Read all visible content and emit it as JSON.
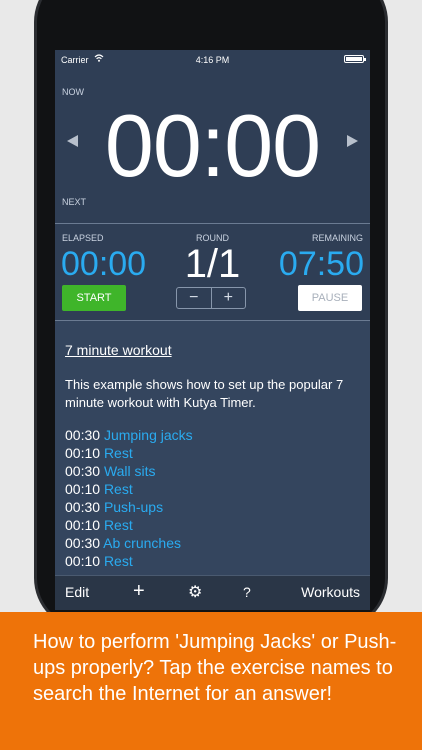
{
  "status_bar": {
    "carrier": "Carrier",
    "time": "4:16 PM"
  },
  "timer": {
    "now_label": "NOW",
    "current_time": "00:00",
    "next_label": "NEXT"
  },
  "stats": {
    "elapsed_label": "ELAPSED",
    "elapsed_value": "00:00",
    "round_label": "ROUND",
    "round_value": "1/1",
    "remaining_label": "REMAINING",
    "remaining_value": "07:50"
  },
  "controls": {
    "start_label": "START",
    "minus_label": "−",
    "plus_label": "+",
    "pause_label": "PAUSE"
  },
  "workout": {
    "title": "7 minute workout",
    "description": "This example shows how to set up the popular 7 minute workout with Kutya Timer.",
    "exercises": [
      {
        "duration": "00:30",
        "name": "Jumping jacks"
      },
      {
        "duration": "00:10",
        "name": "Rest"
      },
      {
        "duration": "00:30",
        "name": "Wall sits"
      },
      {
        "duration": "00:10",
        "name": "Rest"
      },
      {
        "duration": "00:30",
        "name": "Push-ups"
      },
      {
        "duration": "00:10",
        "name": "Rest"
      },
      {
        "duration": "00:30",
        "name": "Ab crunches"
      },
      {
        "duration": "00:10",
        "name": "Rest"
      }
    ]
  },
  "toolbar": {
    "edit_label": "Edit",
    "add_label": "+",
    "settings_label": "⚙",
    "help_label": "?",
    "workouts_label": "Workouts"
  },
  "banner": {
    "text": "How to perform 'Jumping Jacks' or Push-ups properly? Tap the exercise names to search the Internet for an answer!"
  },
  "colors": {
    "accent_blue": "#2aabf0",
    "start_green": "#3fb52a",
    "banner_orange": "#ee7309",
    "screen_bg": "#2f3e55"
  },
  "icons": {
    "prev": "triangle-left-icon",
    "next": "triangle-right-icon",
    "wifi": "wifi-icon",
    "battery": "battery-icon",
    "settings": "gear-icon"
  }
}
